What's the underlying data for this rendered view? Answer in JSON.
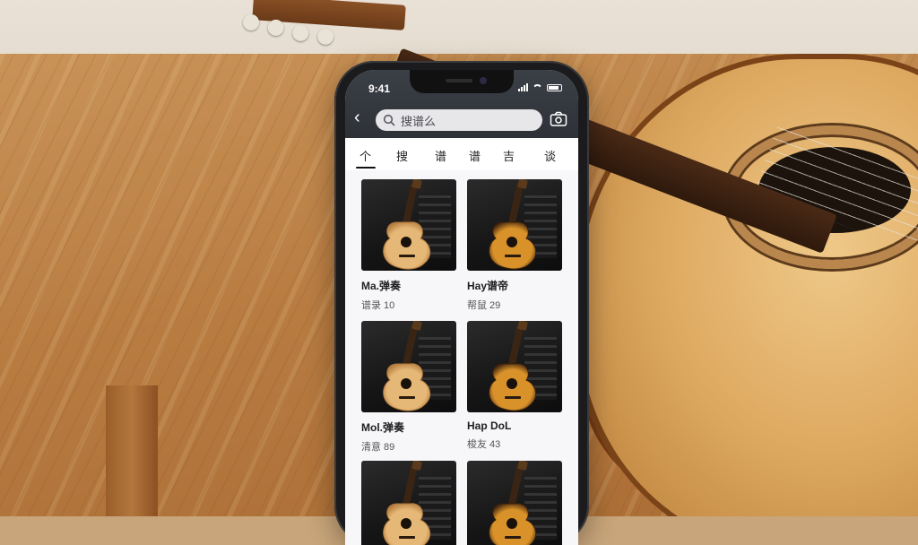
{
  "status_bar": {
    "time": "9:41"
  },
  "search": {
    "placeholder": "搜谱么",
    "back_label": "‹"
  },
  "tabs": [
    {
      "label": "个"
    },
    {
      "label": "搜"
    },
    {
      "label": "谱"
    },
    {
      "label": "谱"
    },
    {
      "label": "吉"
    },
    {
      "label": "谈"
    }
  ],
  "cards": [
    {
      "title": "Ma.弹奏",
      "meta": "谱录 10",
      "finish": "natural"
    },
    {
      "title": "Hay谱帝",
      "meta": "帮鼠 29",
      "finish": "sunburst"
    },
    {
      "title": "Mol.弹奏",
      "meta": "清意 89",
      "finish": "natural"
    },
    {
      "title": "Hap DoL",
      "meta": "梭友 43",
      "finish": "sunburst"
    },
    {
      "title": "",
      "meta": "",
      "finish": "natural"
    },
    {
      "title": "",
      "meta": "",
      "finish": "sunburst"
    }
  ],
  "colors": {
    "header_bg": "#2e3238",
    "search_bg": "#e7e7ea",
    "natural_top": "#e6b877",
    "sunburst_top": "#d9922a"
  },
  "icons": [
    "back-chevron-icon",
    "search-icon",
    "camera-icon",
    "signal-icon",
    "wifi-icon",
    "battery-icon",
    "guitar-icon"
  ]
}
